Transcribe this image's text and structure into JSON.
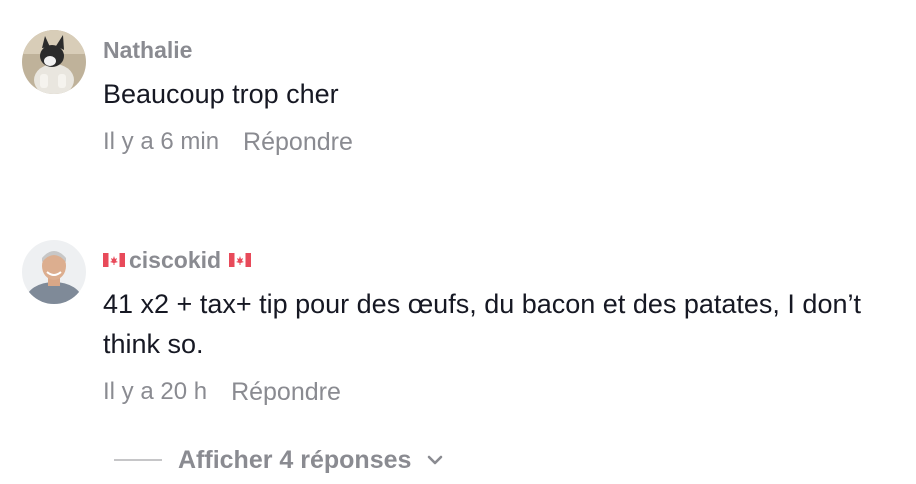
{
  "comments": [
    {
      "username": "Nathalie",
      "text": "Beaucoup trop cher",
      "time": "Il y a 6 min",
      "reply_label": "Répondre"
    },
    {
      "username": "ciscokid",
      "text": "41 x2 + tax+ tip pour des œufs, du bacon et des patates, I don’t think so.",
      "time": "Il y a 20 h",
      "reply_label": "Répondre"
    }
  ],
  "replies_toggle": {
    "label": "Afficher 4 réponses"
  },
  "colors": {
    "text_primary": "#161823",
    "text_secondary": "#8a8b91",
    "flag_red": "#e84a5a"
  }
}
